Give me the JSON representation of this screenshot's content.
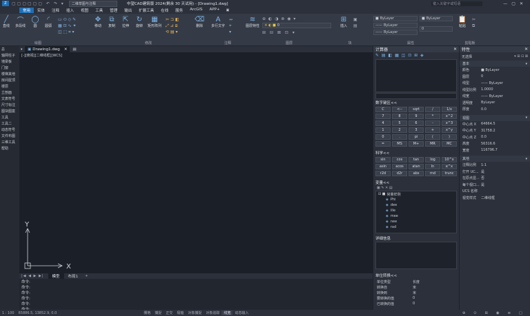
{
  "title_bar": {
    "workspace": "二维草图与注释",
    "title": "中望CAD建筑版 2024(剩余 30 天试用) - [Drawing1.dwg]",
    "search_placeholder": "键入关键字或短语"
  },
  "menu": [
    "常用",
    "实体",
    "注释",
    "插入",
    "视图",
    "工具",
    "管理",
    "输出",
    "扩展工具",
    "在线",
    "服务",
    "ArcGIS",
    "APP+"
  ],
  "ribbon": {
    "draw_buttons": [
      "直线",
      "多段线",
      "圆",
      "圆弧"
    ],
    "modify_buttons": [
      "移动",
      "复制",
      "拉伸",
      "旋转",
      "矩形阵列",
      "删除"
    ],
    "annotation_buttons": [
      "多行文字"
    ],
    "layer_buttons": [
      "图层特性"
    ],
    "block_buttons": [
      "插入"
    ],
    "clipboard_buttons": [
      "粘贴"
    ],
    "groups": [
      "绘图",
      "修改",
      "注释",
      "图层",
      "块",
      "属性",
      "剪贴板"
    ],
    "layer_value": "0",
    "color_value": "ByLayer",
    "linetype_value": "ByLayer",
    "lineweight_value": "ByLayer",
    "number_value": "0"
  },
  "left_panel": [
    "总",
    "轴网柱子",
    "墙梁板",
    "门窗",
    "楼梯其他",
    "房间屋顶",
    "楼层",
    "立剖面",
    "文表符号",
    "尺寸标注",
    "图块图案",
    "工具",
    "工具二",
    "动态符号",
    "文件布图",
    "三维工具",
    "帮助"
  ],
  "doc_tab": "Drawing1.dwg",
  "viewport_label": "[-][俯视][二维线框][WCS]",
  "layout_tabs": [
    "模型",
    "布局1"
  ],
  "command_lines": [
    "命令:",
    "命令:",
    "命令:",
    "命令:",
    "命令:",
    "命令:"
  ],
  "calc": {
    "title": "计算器",
    "number_keys_title": "数字键区<<",
    "number_keys": [
      [
        "C",
        "<--",
        "sqrt",
        "/",
        "1/x"
      ],
      [
        "7",
        "8",
        "9",
        "*",
        "x^2"
      ],
      [
        "4",
        "5",
        "6",
        "-",
        "x^3"
      ],
      [
        "1",
        "2",
        "3",
        "+",
        "x^y"
      ],
      [
        "0",
        ".",
        "pi",
        "(",
        ")"
      ],
      [
        "=",
        "MS",
        "M+",
        "MR",
        "MC"
      ]
    ],
    "sci_title": "科学<<",
    "sci_keys": [
      [
        "sin",
        "cos",
        "tan",
        "log",
        "10^x"
      ],
      [
        "asin",
        "acos",
        "atan",
        "ln",
        "e^x"
      ],
      [
        "r2d",
        "d2r",
        "abs",
        "rnd",
        "trunc"
      ]
    ],
    "vars_title": "变量<<",
    "vars_group": "常量样例",
    "vars": [
      "Phi",
      "dee",
      "ille",
      "mee",
      "nee",
      "rad"
    ],
    "details_title": "详细信息",
    "units_title": "单位转换<<",
    "units": [
      {
        "k": "单位类型",
        "v": "长度"
      },
      {
        "k": "转换自",
        "v": "米"
      },
      {
        "k": "转换到",
        "v": "米"
      },
      {
        "k": "要转换的值",
        "v": "0"
      },
      {
        "k": "已转换的值",
        "v": "0"
      }
    ]
  },
  "props": {
    "title": "特性",
    "selection": "无选择",
    "basic_title": "基本",
    "basic": [
      {
        "k": "颜色",
        "v": "■ ByLayer"
      },
      {
        "k": "图层",
        "v": "0"
      },
      {
        "k": "线型",
        "v": "—— ByLayer"
      },
      {
        "k": "线型比例",
        "v": "1.0000"
      },
      {
        "k": "线宽",
        "v": "—— ByLayer"
      },
      {
        "k": "透明度",
        "v": "ByLayer"
      },
      {
        "k": "厚度",
        "v": "0.0"
      }
    ],
    "view_title": "视图",
    "view": [
      {
        "k": "中心点 X",
        "v": "64664.5"
      },
      {
        "k": "中心点 Y",
        "v": "31758.2"
      },
      {
        "k": "中心点 Z",
        "v": "0.0"
      },
      {
        "k": "高度",
        "v": "56316.6"
      },
      {
        "k": "宽度",
        "v": "116796.7"
      }
    ],
    "misc_title": "其他",
    "misc": [
      {
        "k": "注释比例",
        "v": "1:1"
      },
      {
        "k": "打开 UC...",
        "v": "是"
      },
      {
        "k": "在原点显...",
        "v": "否"
      },
      {
        "k": "每个视口...",
        "v": "是"
      },
      {
        "k": "UCS 名称",
        "v": ""
      },
      {
        "k": "视觉样式",
        "v": "二维线框"
      }
    ]
  },
  "status": {
    "scale": "1 : 100",
    "coords": "65886.5, 13852.9, 0.0",
    "toggles": [
      "栅格",
      "捕捉",
      "正交",
      "极轴",
      "对象捕捉",
      "对象追踪",
      "线宽",
      "动态输入"
    ]
  }
}
